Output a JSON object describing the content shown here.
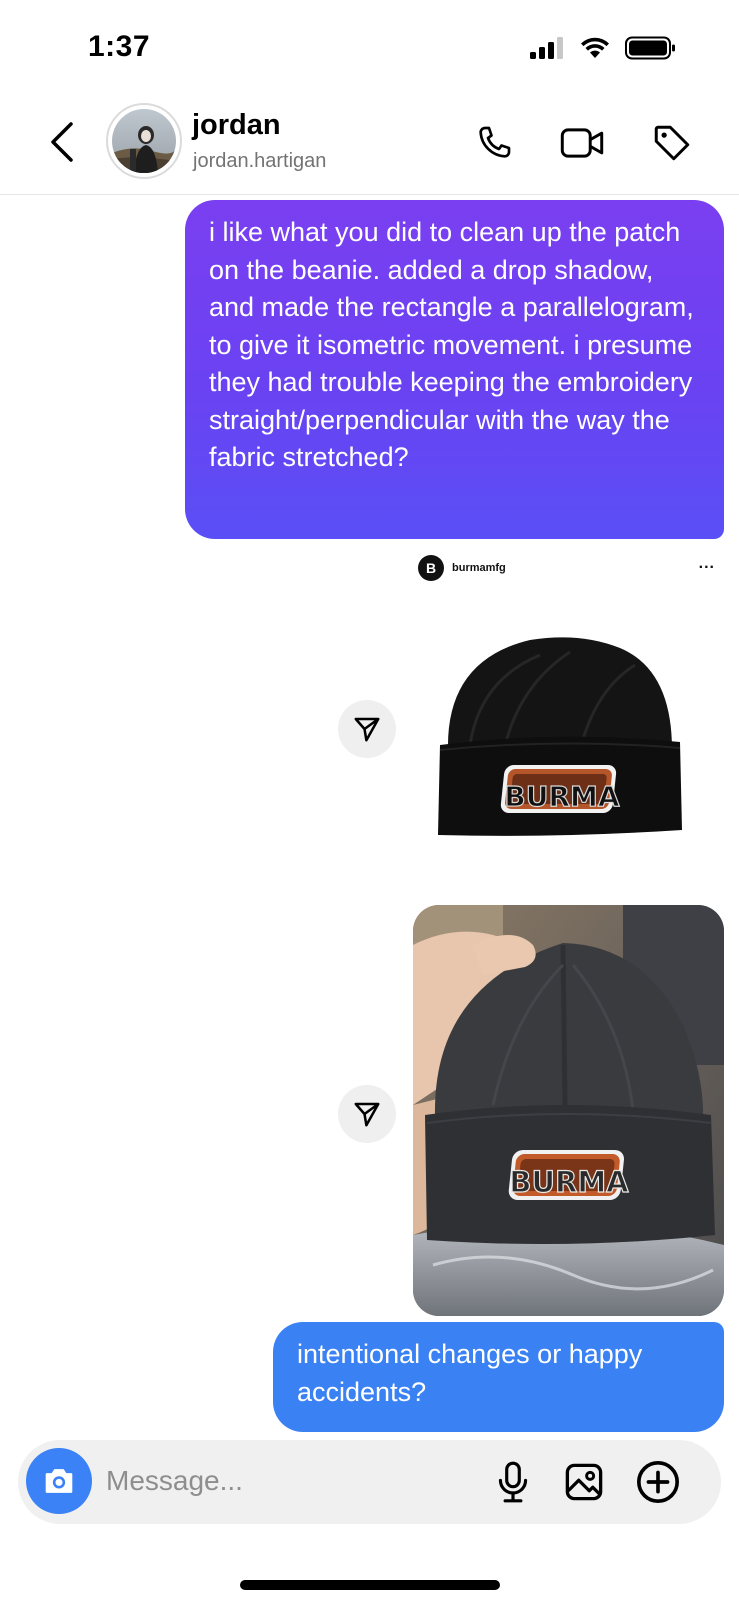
{
  "status_bar": {
    "time": "1:37",
    "signal_icon": "cellular-signal-icon",
    "wifi_icon": "wifi-icon",
    "battery_icon": "battery-icon"
  },
  "header": {
    "back_icon": "chevron-left-icon",
    "display_name": "jordan",
    "username": "jordan.hartigan",
    "actions": [
      "phone-icon",
      "video-camera-icon",
      "tag-icon"
    ]
  },
  "messages": [
    {
      "type": "text",
      "direction": "outgoing",
      "text": "i like what you did to clean up the patch on the beanie. added a drop shadow, and made the rectangle a parallelogram, to give it isometric movement. i presume they had trouble keeping the embroidery straight/perpendicular with the way the fabric stretched?",
      "color": "#6a42f2"
    },
    {
      "type": "shared_post",
      "author": "burmamfg",
      "avatar_letter": "B",
      "more": "...",
      "image": "black-beanie-product-photo",
      "patch_text": "BURMA"
    },
    {
      "type": "photo",
      "image": "gray-beanie-in-hand-photo",
      "patch_text": "BURMA"
    },
    {
      "type": "text",
      "direction": "outgoing",
      "text": "intentional changes or happy accidents?",
      "color": "#3a82f3"
    }
  ],
  "composer": {
    "placeholder": "Message...",
    "value": "",
    "camera_icon": "camera-icon",
    "icons": [
      "microphone-icon",
      "image-gallery-icon",
      "plus-circle-icon"
    ],
    "accent": "#3b82f6"
  }
}
